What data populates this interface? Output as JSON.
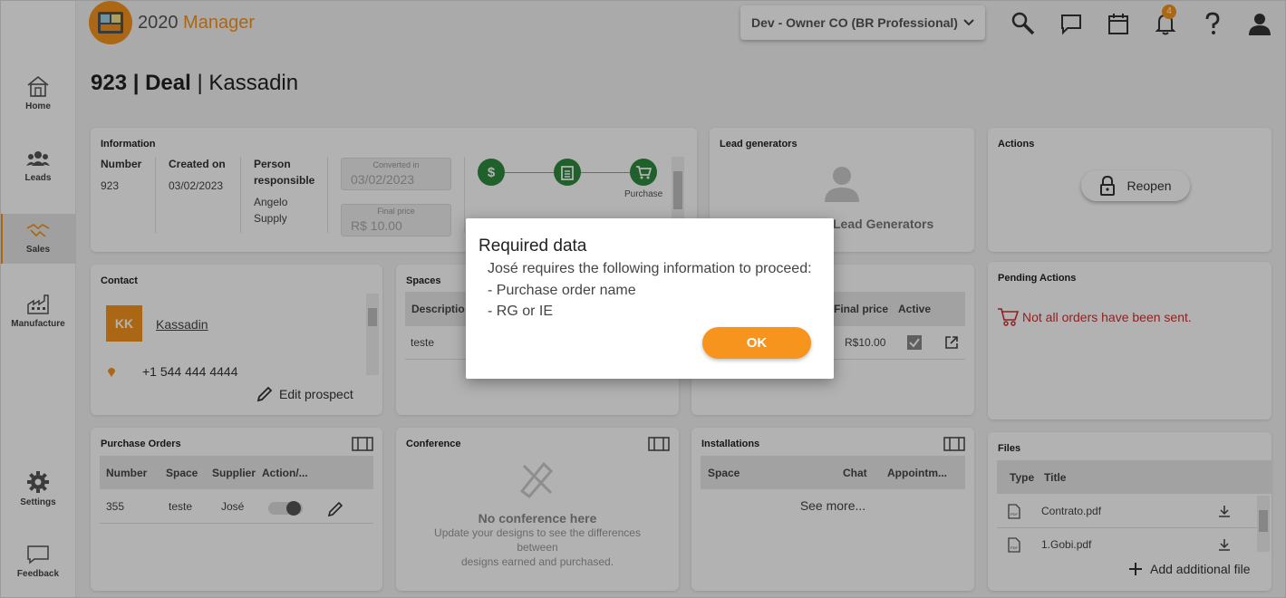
{
  "app": {
    "name_prefix": "2020",
    "name_suffix": " Manager",
    "company": "Dev - Owner CO (BR Professional)",
    "notification_count": "4"
  },
  "sidebar": {
    "items": [
      {
        "label": "Home"
      },
      {
        "label": "Leads"
      },
      {
        "label": "Sales"
      },
      {
        "label": "Manufacture"
      },
      {
        "label": "Settings"
      },
      {
        "label": "Feedback"
      }
    ]
  },
  "title": {
    "id": "923 | Deal",
    "name": "Kassadin"
  },
  "information": {
    "title": "Information",
    "number_label": "Number",
    "number_value": "923",
    "created_label": "Created on",
    "created_value": "03/02/2023",
    "person_label_1": "Person",
    "person_label_2": "responsible",
    "person_value_1": "Angelo",
    "person_value_2": "Supply",
    "converted_label": "Converted in",
    "converted_value": "03/02/2023",
    "final_price_label": "Final price",
    "final_price_value": "R$ 10.00",
    "step_purchase_label": "Purchase"
  },
  "lead_generators": {
    "title": "Lead generators",
    "empty_label": "Lead Generators"
  },
  "actions": {
    "title": "Actions",
    "reopen_label": "Reopen"
  },
  "contact": {
    "title": "Contact",
    "initials": "KK",
    "name": "Kassadin",
    "phone": "+1 544 444 4444",
    "edit_label": "Edit prospect"
  },
  "spaces": {
    "title": "Spaces",
    "col_description": "Descriptio",
    "row_value": "teste"
  },
  "orders": {
    "col_final_price": "Final price",
    "col_active": "Active",
    "row_price": "R$10.00"
  },
  "pending": {
    "title": "Pending Actions",
    "message": "Not all orders have been sent."
  },
  "purchase_orders": {
    "title": "Purchase Orders",
    "columns": [
      "Number",
      "Space",
      "Supplier",
      "Action/..."
    ],
    "row": {
      "number": "355",
      "space": "teste",
      "supplier": "José"
    }
  },
  "conference": {
    "title": "Conference",
    "empty_title": "No conference here",
    "empty_line1": "Update your designs to see the differences",
    "empty_line2": "between",
    "empty_line3": "designs earned and purchased."
  },
  "installations": {
    "title": "Installations",
    "columns": [
      "Space",
      "Chat",
      "Appointm..."
    ],
    "see_more": "See more..."
  },
  "files": {
    "title": "Files",
    "col_type": "Type",
    "col_title": "Title",
    "items": [
      {
        "name": "Contrato.pdf"
      },
      {
        "name": "1.Gobi.pdf"
      }
    ],
    "add_label": "Add additional file"
  },
  "modal": {
    "title": "Required data",
    "intro": "José requires the following information to proceed:",
    "items": [
      "- Purchase order name",
      "- RG or IE"
    ],
    "ok_label": "OK"
  },
  "colors": {
    "accent": "#f7941d",
    "success": "#2e8b3e",
    "warning_text": "#d03030"
  }
}
